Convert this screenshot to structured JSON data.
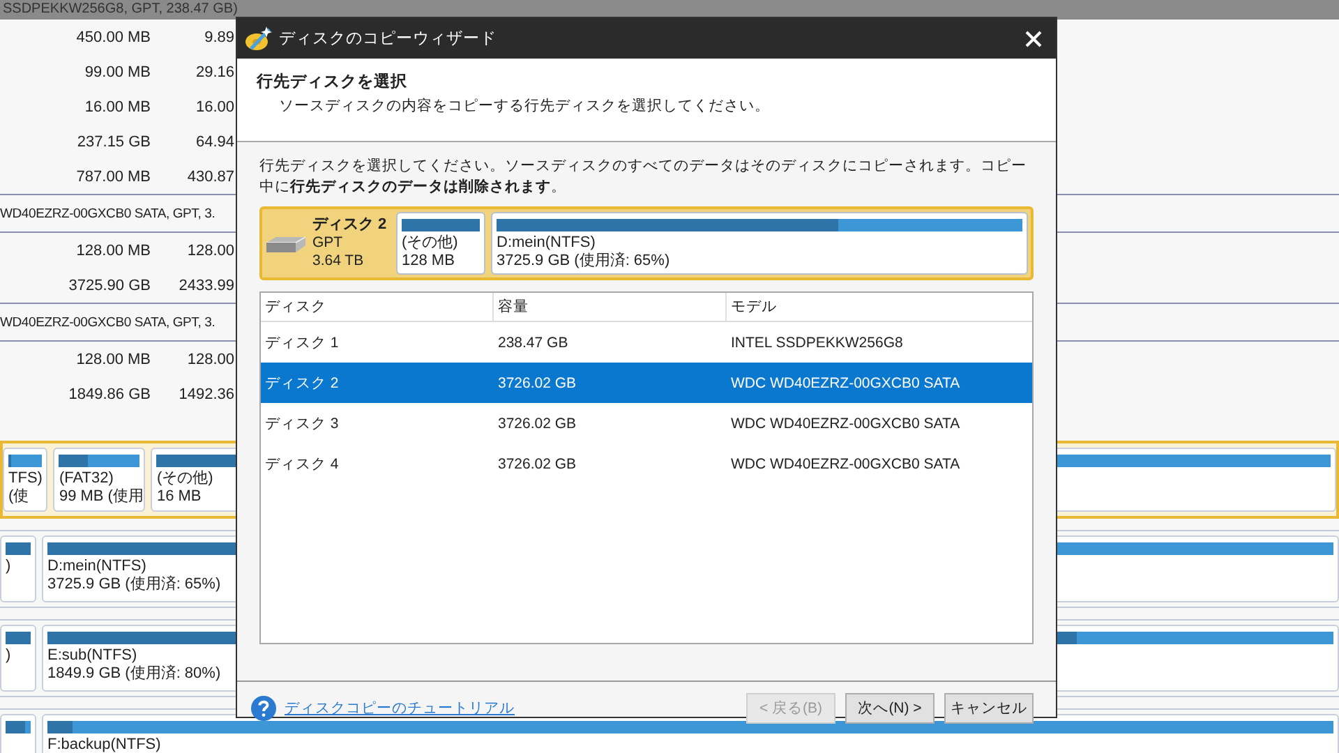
{
  "background": {
    "top_bar": "SSDPEKKW256G8, GPT, 238.47 GB)",
    "groups": [
      {
        "rows": [
          {
            "size": "450.00 MB",
            "used": "9.89"
          },
          {
            "size": "99.00 MB",
            "used": "29.16"
          },
          {
            "size": "16.00 MB",
            "used": "16.00"
          },
          {
            "size": "237.15 GB",
            "used": "64.94"
          },
          {
            "size": "787.00 MB",
            "used": "430.87"
          }
        ]
      },
      {
        "header": "WD40EZRZ-00GXCB0 SATA, GPT, 3.",
        "rows": [
          {
            "size": "128.00 MB",
            "used": "128.00"
          },
          {
            "size": "3725.90 GB",
            "used": "2433.99"
          }
        ]
      },
      {
        "header": "WD40EZRZ-00GXCB0 SATA, GPT, 3.",
        "rows": [
          {
            "size": "128.00 MB",
            "used": "128.00"
          },
          {
            "size": "1849.86 GB",
            "used": "1492.36"
          }
        ]
      }
    ],
    "disk_map": [
      {
        "selected": true,
        "partitions": [
          {
            "label": "TFS)",
            "detail": "(使",
            "level": 0.1
          },
          {
            "label": "(FAT32)",
            "detail": "99 MB (使用",
            "level": 0.35
          },
          {
            "label": "(その他)",
            "detail": "16 MB",
            "level": 1
          },
          {
            "level": 0.2
          }
        ]
      },
      {
        "selected": false,
        "partitions": [
          {
            "label": ")",
            "level": 1
          },
          {
            "label": "D:mein(NTFS)",
            "detail": "3725.9 GB (使用済: 65%)",
            "level": 0.65
          }
        ]
      },
      {
        "selected": false,
        "partitions": [
          {
            "label": ")",
            "level": 1
          },
          {
            "label": "E:sub(NTFS)",
            "detail": "1849.9 GB (使用済: 80%)",
            "level": 0.8
          }
        ]
      },
      {
        "selected": false,
        "partitions": [
          {
            "level": 0.8
          },
          {
            "label": "F:backup(NTFS)",
            "level": 0.02
          }
        ]
      }
    ]
  },
  "dialog": {
    "title": "ディスクのコピーウィザード",
    "heading": "行先ディスクを選択",
    "subheading": "ソースディスクの内容をコピーする行先ディスクを選択してください。",
    "instructions": "行先ディスクを選択してください。ソースディスクのすべてのデータはそのディスクにコピーされます。コピー中に**行先ディスクのデータは削除されます**。",
    "target_disk": {
      "name": "ディスク 2",
      "style": "GPT",
      "capacity": "3.64 TB",
      "partitions": [
        {
          "label": "(その他)",
          "detail": "128 MB",
          "level": 1
        },
        {
          "label": "D:mein(NTFS)",
          "detail": "3725.9 GB (使用済: 65%)",
          "level": 0.65
        }
      ]
    },
    "table": {
      "columns": [
        "ディスク",
        "容量",
        "モデル"
      ],
      "rows": [
        {
          "cells": [
            "ディスク 1",
            "238.47 GB",
            "INTEL SSDPEKKW256G8"
          ],
          "selected": false
        },
        {
          "cells": [
            "ディスク 2",
            "3726.02 GB",
            "WDC WD40EZRZ-00GXCB0 SATA"
          ],
          "selected": true
        },
        {
          "cells": [
            "ディスク 3",
            "3726.02 GB",
            "WDC WD40EZRZ-00GXCB0 SATA"
          ],
          "selected": false
        },
        {
          "cells": [
            "ディスク 4",
            "3726.02 GB",
            "WDC WD40EZRZ-00GXCB0 SATA"
          ],
          "selected": false
        }
      ]
    },
    "help_link": "ディスクコピーのチュートリアル",
    "buttons": [
      {
        "label": "< 戻る(B)",
        "disabled": true
      },
      {
        "label": "次へ(N) >",
        "disabled": false
      },
      {
        "label": "キャンセル",
        "disabled": false
      }
    ]
  }
}
